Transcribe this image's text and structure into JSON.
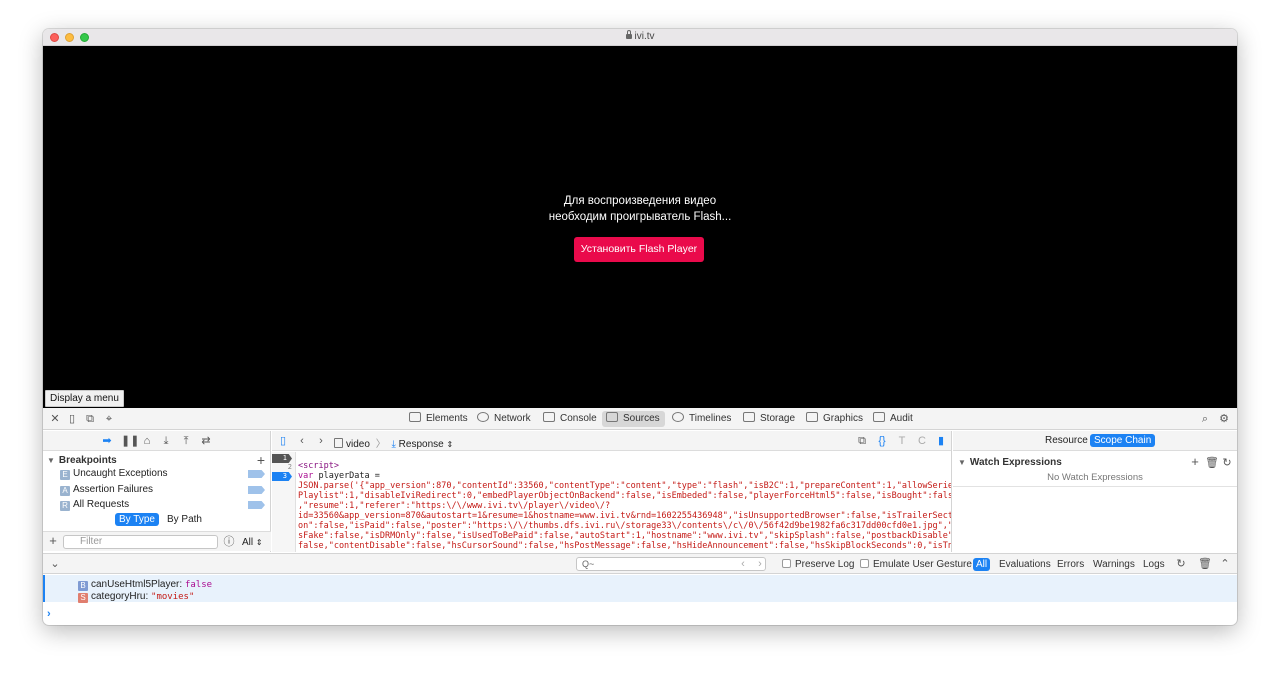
{
  "window": {
    "url": "ivi.tv"
  },
  "video": {
    "message_line1": "Для воспроизведения видео",
    "message_line2": "необходим проигрыватель Flash...",
    "flash_button": "Установить Flash Player",
    "menu_tooltip": "Display a menu"
  },
  "devtools": {
    "tabs": [
      {
        "label": "Elements"
      },
      {
        "label": "Network"
      },
      {
        "label": "Console"
      },
      {
        "label": "Sources"
      },
      {
        "label": "Timelines"
      },
      {
        "label": "Storage"
      },
      {
        "label": "Graphics"
      },
      {
        "label": "Audit"
      }
    ],
    "active_tab": "Sources"
  },
  "breakpoints": {
    "header": "Breakpoints",
    "items": [
      {
        "icon": "E",
        "label": "Uncaught Exceptions"
      },
      {
        "icon": "A",
        "label": "Assertion Failures"
      },
      {
        "icon": "R",
        "label": "All Requests"
      }
    ],
    "segment": {
      "by_type": "By Type",
      "by_path": "By Path"
    },
    "filter_placeholder": "Filter",
    "filter_scope": "All"
  },
  "editor": {
    "breadcrumb_file": "video",
    "breadcrumb_mode": "Response",
    "line_numbers": [
      "1",
      "2",
      "3"
    ],
    "code_line1": "<script>",
    "code_line2_kw": "var",
    "code_line2_rest": " playerData =",
    "code_line3": "JSON.parse('{\"app_version\":870,\"contentId\":33560,\"contentType\":\"content\",\"type\":\"flash\",\"isB2C\":1,\"prepareContent\":1,\"allowSeries",
    "code_line4": "Playlist\":1,\"disableIviRedirect\":0,\"embedPlayerObjectOnBackend\":false,\"isEmbeded\":false,\"playerForceHtml5\":false,\"isBought\":false",
    "code_line5": ",\"resume\":1,\"referer\":\"https:\\/\\/www.ivi.tv\\/player\\/video\\/?",
    "code_line6": "id=33560&app_version=870&autostart=1&resume=1&hostname=www.ivi.tv&rnd=1602255436948\",\"isUnsupportedBrowser\":false,\"isTrailerSecti",
    "code_line7": "on\":false,\"isPaid\":false,\"poster\":\"https:\\/\\/thumbs.dfs.ivi.ru\\/storage33\\/contents\\/c\\/0\\/56f42d9be1982fa6c317dd00cfd0e1.jpg\",\"i",
    "code_line8": "sFake\":false,\"isDRMOnly\":false,\"isUsedToBePaid\":false,\"autoStart\":1,\"hostname\":\"www.ivi.tv\",\"skipSplash\":false,\"postbackDisable\":",
    "code_line9": "false,\"contentDisable\":false,\"hsCursorSound\":false,\"hsPostMessage\":false,\"hsHideAnnouncement\":false,\"hsSkipBlockSeconds\":0,\"isTns"
  },
  "right_sidebar": {
    "tab_resource": "Resource",
    "tab_scope": "Scope Chain",
    "watch_header": "Watch Expressions",
    "watch_empty": "No Watch Expressions"
  },
  "console": {
    "search_placeholder": "Q~",
    "preserve_log": "Preserve Log",
    "emulate_gesture": "Emulate User Gesture",
    "filters": [
      "All",
      "Evaluations",
      "Errors",
      "Warnings",
      "Logs"
    ],
    "properties": [
      {
        "badge": "B",
        "badge_color": "#7f9bd3",
        "key": "canUseHtml5Player:",
        "value": "false",
        "kind": "bool"
      },
      {
        "badge": "S",
        "badge_color": "#e07e6e",
        "key": "categoryHru:",
        "value": "\"movies\"",
        "kind": "str"
      }
    ],
    "prompt": "›"
  },
  "colors": {
    "accent": "#1c82f3",
    "flash_button": "#ea0a4b"
  }
}
